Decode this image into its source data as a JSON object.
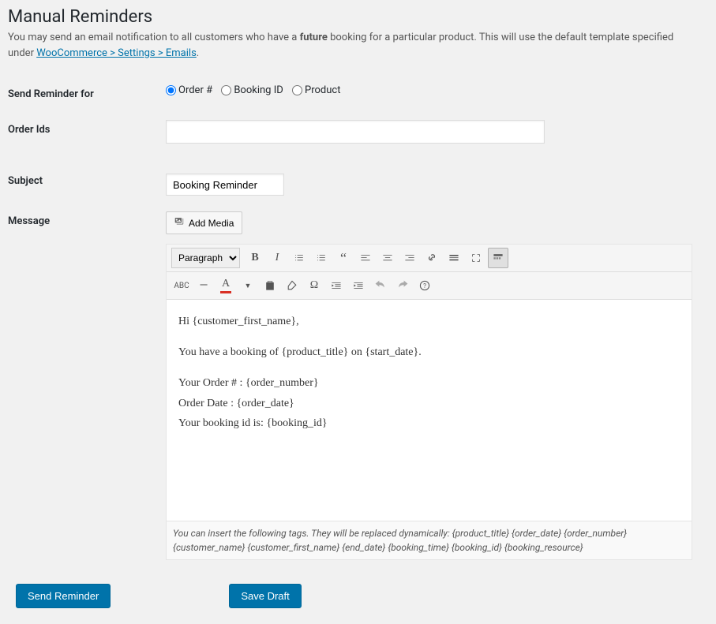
{
  "header": {
    "title": "Manual Reminders",
    "desc_prefix": "You may send an email notification to all customers who have a ",
    "desc_bold": "future",
    "desc_mid": " booking for a particular product. This will use the default template specified under ",
    "desc_link": "WooCommerce > Settings > Emails",
    "desc_suffix": "."
  },
  "form": {
    "reminder_for_label": "Send Reminder for",
    "radio_order": "Order #",
    "radio_booking": "Booking ID",
    "radio_product": "Product",
    "order_ids_label": "Order Ids",
    "order_ids_value": "",
    "subject_label": "Subject",
    "subject_value": "Booking Reminder",
    "message_label": "Message",
    "add_media_label": "Add Media"
  },
  "editor": {
    "format_option": "Paragraph",
    "content_line1": "Hi {customer_first_name},",
    "content_line2": "You have a booking of {product_title} on {start_date}.",
    "content_line3": "Your Order # : {order_number}",
    "content_line4": "Order Date : {order_date}",
    "content_line5": "Your booking id is: {booking_id}"
  },
  "tags_note": {
    "prefix": "You can insert the following tags. They will be replaced dynamically:  ",
    "tags": "{product_title} {order_date} {order_number} {customer_name} {customer_first_name} {end_date} {booking_time} {booking_id} {booking_resource}"
  },
  "buttons": {
    "send_reminder": "Send Reminder",
    "save_draft": "Save Draft"
  },
  "icons": {
    "media": "media-icon",
    "bold": "B",
    "italic": "I"
  }
}
